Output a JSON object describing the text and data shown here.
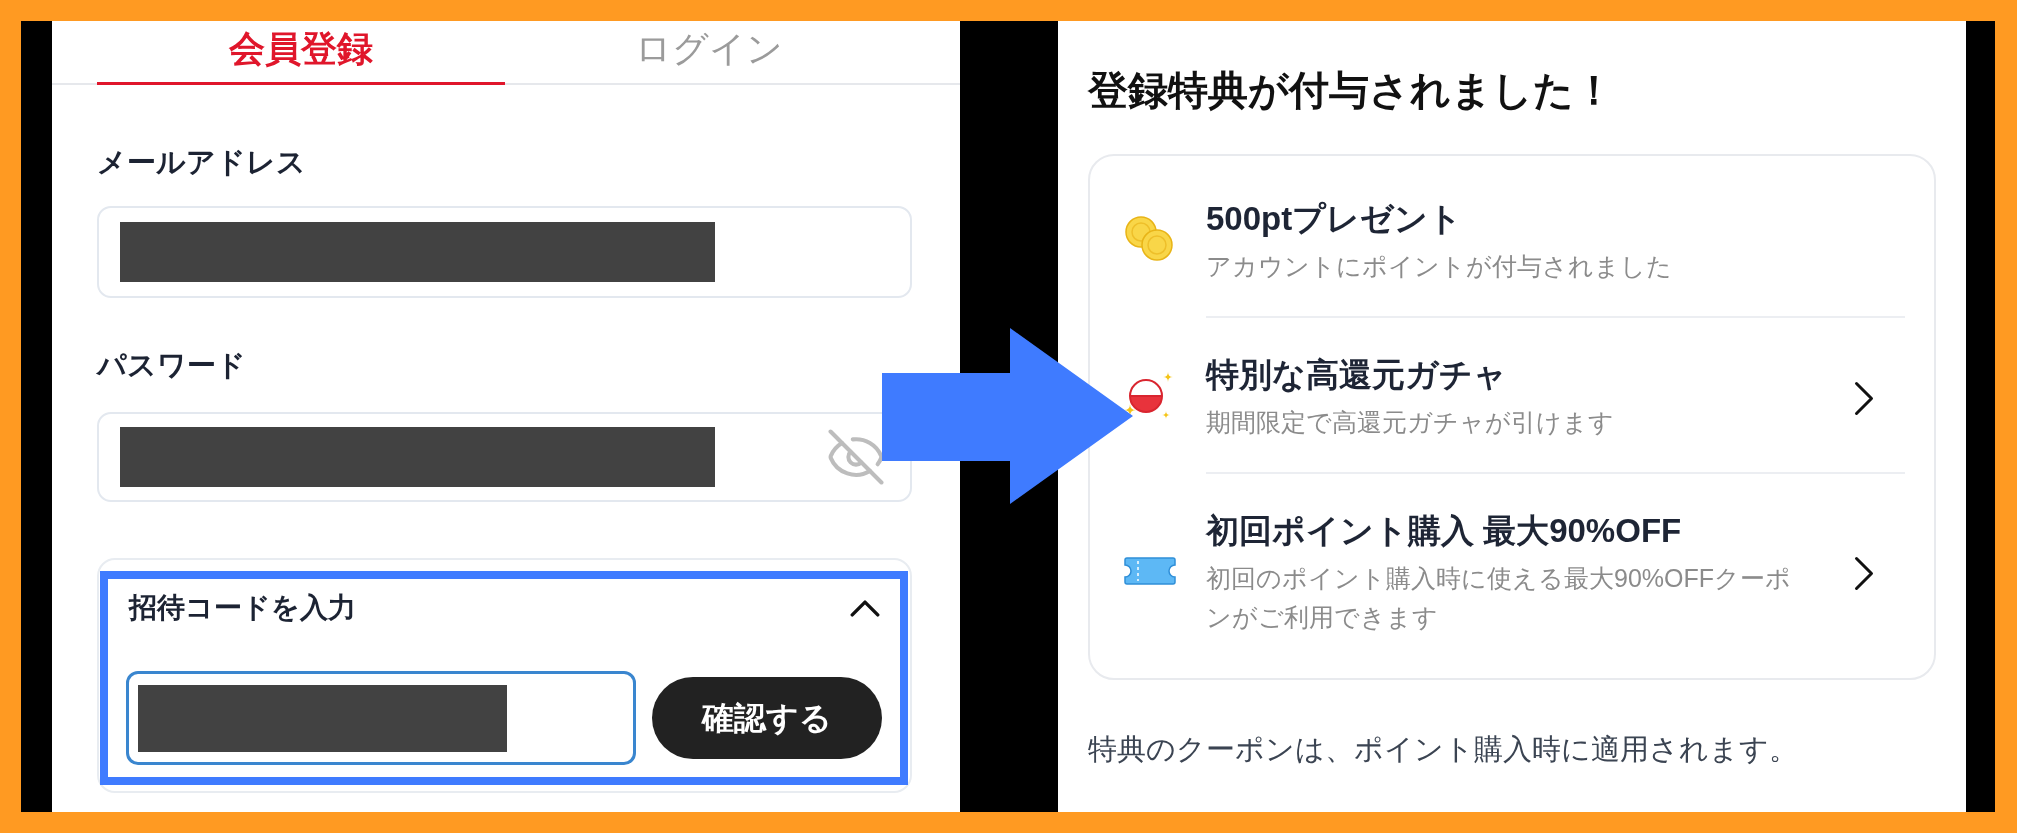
{
  "left_screen": {
    "tabs": [
      {
        "label": "会員登録",
        "selected": true
      },
      {
        "label": "ログイン",
        "selected": false
      }
    ],
    "fields": [
      {
        "label": "メールアドレス",
        "kind": "email",
        "redacted": true
      },
      {
        "label": "パスワード",
        "kind": "password",
        "redacted": true
      }
    ],
    "invite_code": {
      "title": "招待コードを入力",
      "expanded": true,
      "highlighted": true,
      "focused": true,
      "redacted": true,
      "button": "確認する"
    }
  },
  "right_screen": {
    "title": "登録特典が付与されました！",
    "benefits": [
      {
        "kind": "coins",
        "title": "500ptプレゼント",
        "description": "アカウントにポイントが付与されました",
        "navigable": false
      },
      {
        "kind": "ball",
        "title": "特別な高還元ガチャ",
        "description": "期間限定で高還元ガチャが引けます",
        "navigable": true
      },
      {
        "kind": "ticket",
        "title": "初回ポイント購入 最大90%OFF",
        "description": "初回のポイント購入時に使える最大90%OFFクーポンがご利用できます",
        "navigable": true
      }
    ],
    "note": "特典のクーポンは、ポイント購入時に適用されます。"
  }
}
